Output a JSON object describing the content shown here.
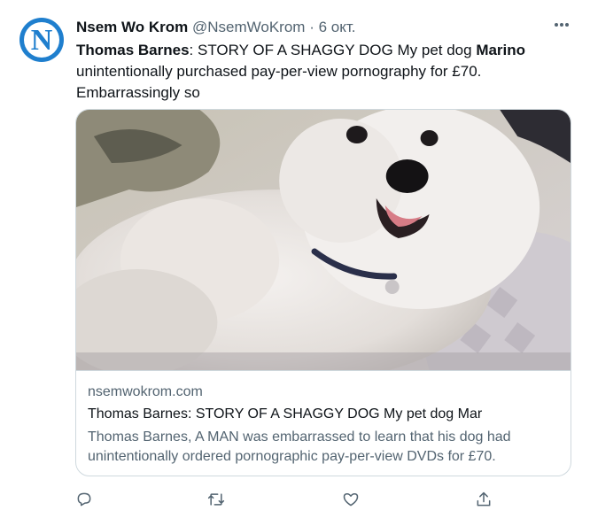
{
  "tweet": {
    "avatar_letter": "N",
    "author_name": "Nsem Wo Krom",
    "author_handle": "@NsemWoKrom",
    "separator": "·",
    "date": "6 окт.",
    "text_part1": "Thomas Barnes",
    "text_part2": ": STORY OF A SHAGGY DOG My pet dog ",
    "text_part3": "Marino",
    "text_part4": " unintentionally purchased pay-per-view pornography for £70. Embarrassingly so"
  },
  "card": {
    "image_subject": "fluffy white dog",
    "domain": "nsemwokrom.com",
    "title": "Thomas Barnes: STORY OF A SHAGGY DOG My pet dog Mar",
    "description": "Thomas Barnes, A MAN was embarrassed to learn that his dog had unintentionally ordered pornographic pay-per-view DVDs for £70."
  },
  "actions": {
    "reply_icon": "reply-icon",
    "retweet_icon": "retweet-icon",
    "like_icon": "like-icon",
    "share_icon": "share-icon"
  },
  "colors": {
    "avatar": "#1f7fce",
    "text": "#0f1419",
    "muted": "#536471",
    "border": "#cfd9de"
  }
}
